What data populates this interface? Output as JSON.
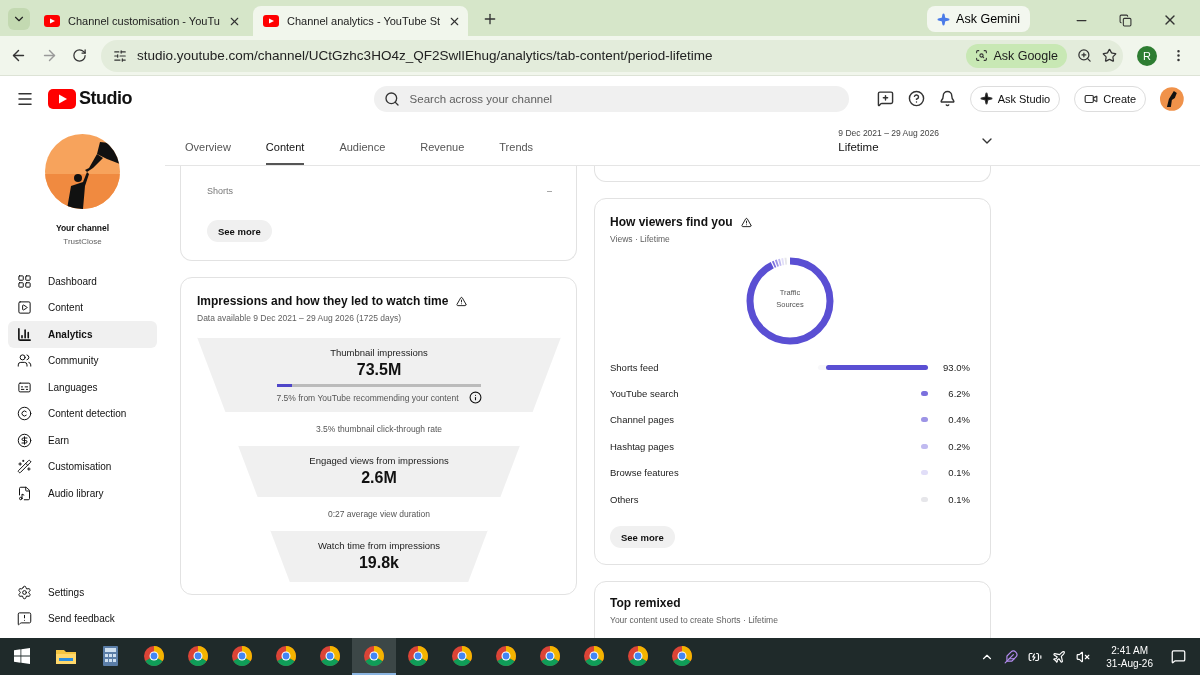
{
  "browser": {
    "tabs": [
      {
        "title": "Channel customisation - YouTu",
        "selected": false
      },
      {
        "title": "Channel analytics - YouTube St",
        "selected": true
      }
    ],
    "ask_gemini": "Ask Gemini",
    "url": "studio.youtube.com/channel/UCtGzhc3HO4z_QF2SwlIEhug/analytics/tab-content/period-lifetime",
    "ask_google": "Ask Google",
    "profile_initial": "R"
  },
  "header": {
    "logo": "Studio",
    "search": {
      "placeholder": "Search across your channel"
    },
    "ask_studio": "Ask Studio",
    "create": "Create"
  },
  "sidebar": {
    "channel_label": "Your channel",
    "channel_name": "TrustClose",
    "items": [
      {
        "label": "Dashboard",
        "selected": false
      },
      {
        "label": "Content",
        "selected": false
      },
      {
        "label": "Analytics",
        "selected": true
      },
      {
        "label": "Community",
        "selected": false
      },
      {
        "label": "Languages",
        "selected": false
      },
      {
        "label": "Content detection",
        "selected": false
      },
      {
        "label": "Earn",
        "selected": false
      },
      {
        "label": "Customisation",
        "selected": false
      },
      {
        "label": "Audio library",
        "selected": false
      }
    ],
    "footer_items": [
      {
        "label": "Settings"
      },
      {
        "label": "Send feedback"
      }
    ]
  },
  "tabs": [
    {
      "label": "Overview",
      "selected": false
    },
    {
      "label": "Content",
      "selected": true
    },
    {
      "label": "Audience",
      "selected": false
    },
    {
      "label": "Revenue",
      "selected": false
    },
    {
      "label": "Trends",
      "selected": false
    }
  ],
  "period": {
    "range": "9 Dec 2021 – 29 Aug 2026",
    "label": "Lifetime"
  },
  "content_card": {
    "rows": [
      {
        "label": "Shorts",
        "value": "–"
      }
    ],
    "button": "See more"
  },
  "impressions_card": {
    "title": "Impressions and how they led to watch time",
    "subtitle": "Data available 9 Dec 2021 – 29 Aug 2026 (1725 days)",
    "funnel": [
      {
        "kind": "stage",
        "label": "Thumbnail impressions",
        "value": "73.5M",
        "level": 0.075,
        "note": "7.5% from YouTube recommending your content"
      },
      {
        "kind": "rate",
        "label": "3.5% thumbnail click-through rate"
      },
      {
        "kind": "stage",
        "label": "Engaged views from impressions",
        "value": "2.6M"
      },
      {
        "kind": "rate",
        "label": "0:27 average view duration"
      },
      {
        "kind": "stage",
        "label": "Watch time from impressions",
        "value": "19.8k"
      }
    ]
  },
  "viewers_card": {
    "title": "How viewers find you",
    "subtitle": "Views · Lifetime",
    "donut_label": "Traffic Sources",
    "sources": [
      {
        "kind": "bar",
        "label": "Shorts feed",
        "value": "93.0%",
        "level": 0.93,
        "color": "#5a4fd3"
      },
      {
        "kind": "dot",
        "label": "YouTube search",
        "value": "6.2%",
        "color": "#7b70dd"
      },
      {
        "kind": "dot",
        "label": "Channel pages",
        "value": "0.4%",
        "color": "#9d94e6"
      },
      {
        "kind": "dot",
        "label": "Hashtag pages",
        "value": "0.2%",
        "color": "#c0baf0"
      },
      {
        "kind": "dot",
        "label": "Browse features",
        "value": "0.1%",
        "color": "#e1def8"
      },
      {
        "kind": "dot",
        "label": "Others",
        "value": "0.1%",
        "color": "#e6e6ea"
      }
    ],
    "button": "See more"
  },
  "remixed_card": {
    "title": "Top remixed",
    "subtitle": "Your content used to create Shorts · Lifetime"
  },
  "taskbar": {
    "apps": [
      {
        "kind": "explorer",
        "selected": false
      },
      {
        "kind": "calculator",
        "selected": false
      },
      {
        "kind": "browser",
        "selected": false
      },
      {
        "kind": "browser",
        "selected": false
      },
      {
        "kind": "browser",
        "selected": false
      },
      {
        "kind": "browser",
        "selected": false
      },
      {
        "kind": "browser",
        "selected": false
      },
      {
        "kind": "browser",
        "selected": true
      },
      {
        "kind": "browser",
        "selected": false
      },
      {
        "kind": "browser",
        "selected": false
      },
      {
        "kind": "browser",
        "selected": false
      },
      {
        "kind": "browser",
        "selected": false
      },
      {
        "kind": "browser",
        "selected": false
      },
      {
        "kind": "browser",
        "selected": false
      },
      {
        "kind": "browser",
        "selected": false
      }
    ],
    "time": "2:41 AM",
    "date": "31-Aug-26"
  }
}
